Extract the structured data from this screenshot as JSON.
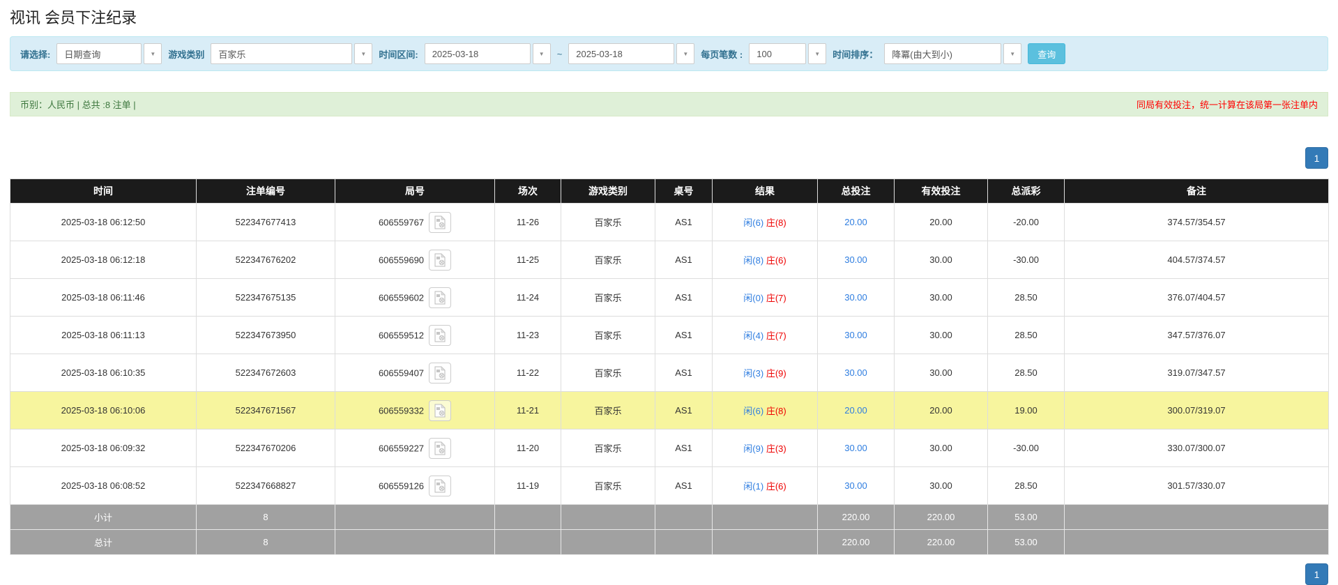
{
  "page": {
    "title": "视讯 会员下注纪录"
  },
  "filters": {
    "select_label": "请选择:",
    "select_value": "日期查询",
    "game_label": "游戏类别",
    "game_value": "百家乐",
    "range_label": "时间区间:",
    "date_from": "2025-03-18",
    "range_separator": "~",
    "date_to": "2025-03-18",
    "page_size_label": "每页笔数 :",
    "page_size_value": "100",
    "sort_label": "时间排序：",
    "sort_value": "降冪(由大到小)",
    "search_button": "查询"
  },
  "summary_bar": {
    "left_text": "币别：人民币 | 总共 :8 注单 |",
    "right_text": "同局有效投注，统一计算在该局第一张注单内"
  },
  "pagination": {
    "page": "1"
  },
  "colors": {
    "accent_blue": "#2e7de0",
    "negative_red": "#ee0000",
    "highlight_yellow": "#f7f59e",
    "header_black": "#1b1b1b",
    "summary_gray": "#a1a1a1"
  },
  "table": {
    "headers": [
      "时间",
      "注单编号",
      "局号",
      "场次",
      "游戏类别",
      "桌号",
      "结果",
      "总投注",
      "有效投注",
      "总派彩",
      "备注"
    ],
    "rows": [
      {
        "time": "2025-03-18 06:12:50",
        "bet_id": "522347677413",
        "round_id": "606559767",
        "session": "11-26",
        "game": "百家乐",
        "table_no": "AS1",
        "result_player": "闲(6)",
        "result_banker": "庄(8)",
        "total_bet": "20.00",
        "valid_bet": "20.00",
        "payout": "-20.00",
        "remark": "374.57/354.57"
      },
      {
        "time": "2025-03-18 06:12:18",
        "bet_id": "522347676202",
        "round_id": "606559690",
        "session": "11-25",
        "game": "百家乐",
        "table_no": "AS1",
        "result_player": "闲(8)",
        "result_banker": "庄(6)",
        "total_bet": "30.00",
        "valid_bet": "30.00",
        "payout": "-30.00",
        "remark": "404.57/374.57"
      },
      {
        "time": "2025-03-18 06:11:46",
        "bet_id": "522347675135",
        "round_id": "606559602",
        "session": "11-24",
        "game": "百家乐",
        "table_no": "AS1",
        "result_player": "闲(0)",
        "result_banker": "庄(7)",
        "total_bet": "30.00",
        "valid_bet": "30.00",
        "payout": "28.50",
        "remark": "376.07/404.57"
      },
      {
        "time": "2025-03-18 06:11:13",
        "bet_id": "522347673950",
        "round_id": "606559512",
        "session": "11-23",
        "game": "百家乐",
        "table_no": "AS1",
        "result_player": "闲(4)",
        "result_banker": "庄(7)",
        "total_bet": "30.00",
        "valid_bet": "30.00",
        "payout": "28.50",
        "remark": "347.57/376.07"
      },
      {
        "time": "2025-03-18 06:10:35",
        "bet_id": "522347672603",
        "round_id": "606559407",
        "session": "11-22",
        "game": "百家乐",
        "table_no": "AS1",
        "result_player": "闲(3)",
        "result_banker": "庄(9)",
        "total_bet": "30.00",
        "valid_bet": "30.00",
        "payout": "28.50",
        "remark": "319.07/347.57"
      },
      {
        "time": "2025-03-18 06:10:06",
        "bet_id": "522347671567",
        "round_id": "606559332",
        "session": "11-21",
        "game": "百家乐",
        "table_no": "AS1",
        "result_player": "闲(6)",
        "result_banker": "庄(8)",
        "total_bet": "20.00",
        "valid_bet": "20.00",
        "payout": "19.00",
        "remark": "300.07/319.07"
      },
      {
        "time": "2025-03-18 06:09:32",
        "bet_id": "522347670206",
        "round_id": "606559227",
        "session": "11-20",
        "game": "百家乐",
        "table_no": "AS1",
        "result_player": "闲(9)",
        "result_banker": "庄(3)",
        "total_bet": "30.00",
        "valid_bet": "30.00",
        "payout": "-30.00",
        "remark": "330.07/300.07"
      },
      {
        "time": "2025-03-18 06:08:52",
        "bet_id": "522347668827",
        "round_id": "606559126",
        "session": "11-19",
        "game": "百家乐",
        "table_no": "AS1",
        "result_player": "闲(1)",
        "result_banker": "庄(6)",
        "total_bet": "30.00",
        "valid_bet": "30.00",
        "payout": "28.50",
        "remark": "301.57/330.07"
      }
    ],
    "subtotal": {
      "label": "小计",
      "count": "8",
      "total_bet": "220.00",
      "valid_bet": "220.00",
      "payout": "53.00"
    },
    "total": {
      "label": "总计",
      "count": "8",
      "total_bet": "220.00",
      "valid_bet": "220.00",
      "payout": "53.00"
    }
  }
}
